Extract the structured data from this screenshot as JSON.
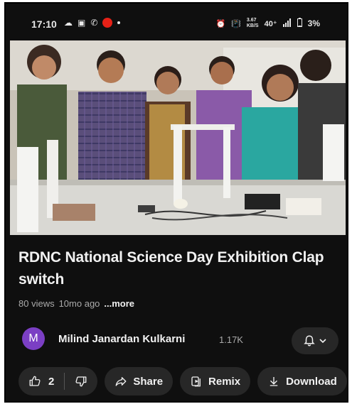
{
  "status_bar": {
    "time": "17:10",
    "right_text": "40⁺",
    "data_speed": "3.67\nKB/S",
    "battery": "3%",
    "icons_left": [
      "cloud-icon",
      "screen-icon",
      "whatsapp-icon",
      "youtube-icon",
      "dot-icon"
    ],
    "icons_right": [
      "alarm-icon",
      "vibrate-icon",
      "data-speed-icon",
      "signal-icon",
      "battery-icon"
    ]
  },
  "video": {
    "thumbnail_icon": "video-thumbnail"
  },
  "title": "RDNC National Science Day Exhibition Clap switch",
  "meta": {
    "views": "80 views",
    "age": "10mo ago",
    "more": "...more"
  },
  "channel": {
    "avatar_letter": "M",
    "name": "Milind Janardan Kulkarni",
    "subscribers": "1.17K",
    "avatar_color": "#7b3fc4"
  },
  "actions": {
    "like_count": "2",
    "share": "Share",
    "remix": "Remix",
    "download": "Download"
  },
  "colors": {
    "background": "#0f0f0f",
    "pill": "#272727",
    "text": "#f1f1f1",
    "secondary_text": "#aaaaaa"
  }
}
